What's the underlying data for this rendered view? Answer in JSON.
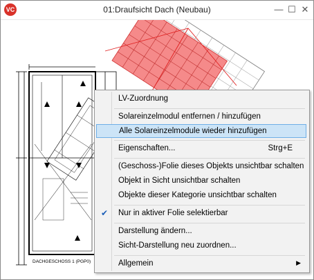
{
  "window": {
    "title": "01:Draufsicht Dach (Neubau)",
    "logo_text": "VC"
  },
  "drawing": {
    "floor_label": "DACHGESCHOSS 1 (PGP0)"
  },
  "context_menu": {
    "items": [
      {
        "label": "LV-Zuordnung"
      },
      {
        "label": "Solareinzelmodul entfernen / hinzufügen"
      },
      {
        "label": "Alle Solareinzelmodule wieder hinzufügen",
        "highlighted": true
      },
      {
        "label": "Eigenschaften...",
        "shortcut": "Strg+E"
      },
      {
        "label": "(Geschoss-)Folie dieses Objekts unsichtbar schalten"
      },
      {
        "label": "Objekt in Sicht unsichtbar schalten"
      },
      {
        "label": "Objekte dieser Kategorie unsichtbar schalten"
      },
      {
        "label": "Nur in aktiver Folie selektierbar",
        "checked": true
      },
      {
        "label": "Darstellung ändern..."
      },
      {
        "label": "Sicht-Darstellung neu zuordnen..."
      },
      {
        "label": "Allgemein",
        "submenu": true
      }
    ]
  },
  "colors": {
    "highlight_bg": "#cce4f7",
    "highlight_border": "#6eaee6",
    "solar_red": "#f26a6a",
    "outline_red": "#e02020"
  }
}
